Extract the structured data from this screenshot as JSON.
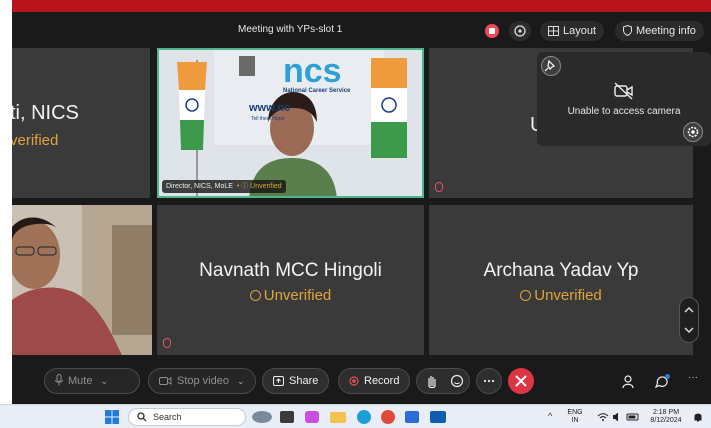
{
  "meeting": {
    "title": "Meeting with YPs-slot 1",
    "layout_label": "Layout",
    "info_label": "Meeting info"
  },
  "tiles": {
    "left_top_name": "ti, NICS",
    "left_top_status": "verified",
    "right_top_partial": "U",
    "navnath_name": "Navnath MCC Hingoli",
    "navnath_status": "Unverified",
    "archana_name": "Archana Yadav Yp",
    "archana_status": "Unverified",
    "video_caption": "Director, NICS, MoLE",
    "video_caption_status": "Unverified",
    "ncs_logo": "ncs",
    "ncs_subtitle": "National Career Service",
    "banner_url": "www.nc",
    "banner_sub": "Tell them Happ"
  },
  "camera": {
    "message": "Unable to access camera"
  },
  "controls": {
    "mute": "Mute",
    "stop_video": "Stop video",
    "share": "Share",
    "record": "Record"
  },
  "taskbar": {
    "search_placeholder": "Search",
    "lang_top": "ENG",
    "lang_bottom": "IN",
    "time": "2:18 PM",
    "date": "8/12/2024"
  },
  "colors": {
    "accent_unverified": "#e0a43a",
    "end_call": "#dc3545",
    "active_border": "#4fb58a",
    "record_red": "#e94b5a"
  }
}
